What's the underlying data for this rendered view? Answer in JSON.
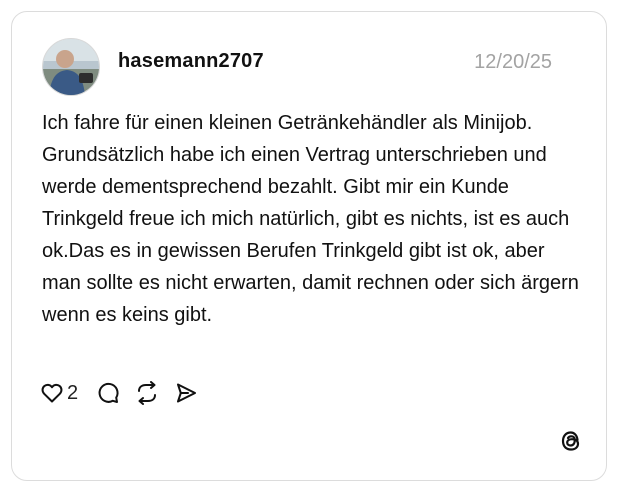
{
  "post": {
    "username": "hasemann2707",
    "date": "12/20/25",
    "text": "Ich fahre für einen kleinen Getränkehändler als Minijob. Grundsätzlich habe ich einen Vertrag unterschrieben und werde dementsprechend bezahlt. Gibt mir ein Kunde Trinkgeld freue ich mich natürlich, gibt es nichts, ist es auch ok.Das es in gewissen Berufen Trinkgeld gibt ist ok, aber man sollte es nicht erwarten, damit rechnen oder sich ärgern wenn es keins gibt.",
    "like_count": "2"
  },
  "icons": {
    "like": "heart-icon",
    "reply": "comment-icon",
    "repost": "repost-icon",
    "share": "send-icon",
    "brand": "threads-logo-icon"
  }
}
